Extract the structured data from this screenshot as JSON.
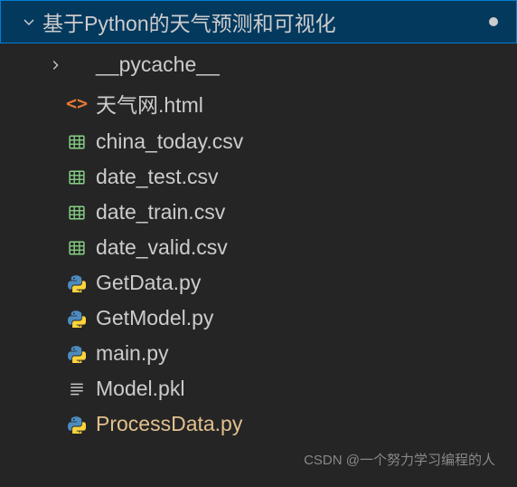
{
  "root": {
    "name": "基于Python的天气预测和可视化",
    "expanded": true,
    "modified": true
  },
  "items": [
    {
      "type": "folder",
      "name": "__pycache__",
      "expanded": false
    },
    {
      "type": "html",
      "name": "天气网.html"
    },
    {
      "type": "csv",
      "name": "china_today.csv"
    },
    {
      "type": "csv",
      "name": "date_test.csv"
    },
    {
      "type": "csv",
      "name": "date_train.csv"
    },
    {
      "type": "csv",
      "name": "date_valid.csv"
    },
    {
      "type": "python",
      "name": "GetData.py"
    },
    {
      "type": "python",
      "name": "GetModel.py"
    },
    {
      "type": "python",
      "name": "main.py"
    },
    {
      "type": "pkl",
      "name": "Model.pkl"
    },
    {
      "type": "python",
      "name": "ProcessData.py",
      "modified": true
    }
  ],
  "watermark": "CSDN @一个努力学习编程的人"
}
